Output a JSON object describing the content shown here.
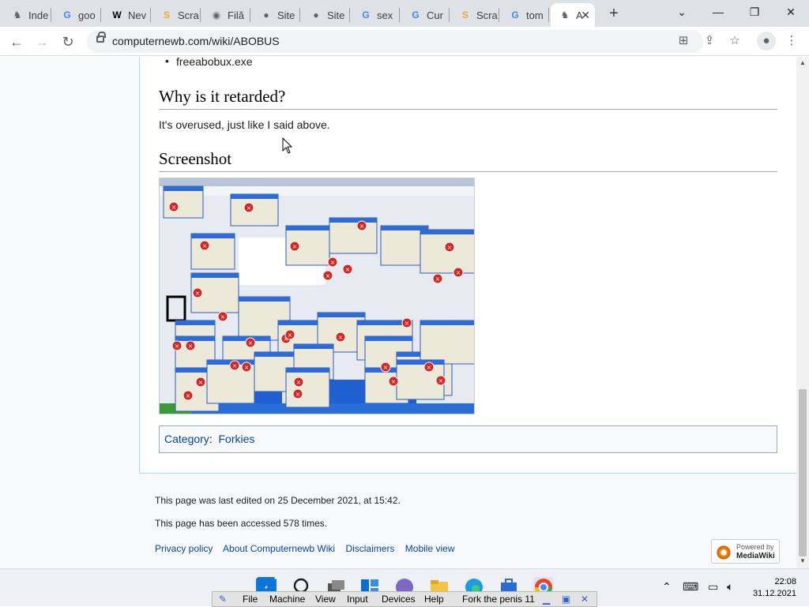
{
  "browser": {
    "tabs": [
      {
        "label": "Inde",
        "icon": "computernewb-icon",
        "icon_glyph": "♞"
      },
      {
        "label": "goo",
        "icon": "google-icon",
        "icon_glyph": "G"
      },
      {
        "label": "Nev",
        "icon": "wikipedia-icon",
        "icon_glyph": "W"
      },
      {
        "label": "Scra",
        "icon": "scratch-icon",
        "icon_glyph": "S"
      },
      {
        "label": "Filă",
        "icon": "chrome-icon",
        "icon_glyph": "◉"
      },
      {
        "label": "Site",
        "icon": "globe-icon",
        "icon_glyph": "●"
      },
      {
        "label": "Site",
        "icon": "globe-icon",
        "icon_glyph": "●"
      },
      {
        "label": "sex",
        "icon": "google-icon",
        "icon_glyph": "G"
      },
      {
        "label": "Cur",
        "icon": "google-icon",
        "icon_glyph": "G"
      },
      {
        "label": "Scra",
        "icon": "scratch-icon",
        "icon_glyph": "S"
      },
      {
        "label": "tom",
        "icon": "google-icon",
        "icon_glyph": "G"
      },
      {
        "label": "A",
        "icon": "computernewb-icon",
        "icon_glyph": "♞",
        "active": true
      }
    ],
    "new_tab": "+",
    "url": "computernewb.com/wiki/ABOBUS"
  },
  "article": {
    "list_item": "freeabobux.exe",
    "heading1": "Why is it retarded?",
    "paragraph1": "It's overused, just like I said above.",
    "heading2": "Screenshot",
    "category_label": "Category",
    "category_sep": ":",
    "category_link": "Forkies"
  },
  "footer": {
    "last_edited": "This page was last edited on 25 December 2021, at 15:42.",
    "accessed": "This page has been accessed 578 times.",
    "links": [
      "Privacy policy",
      "About Computernewb Wiki",
      "Disclaimers",
      "Mobile view"
    ],
    "powered_line1": "Powered by",
    "powered_line2": "MediaWiki"
  },
  "vbox": {
    "menu": [
      "File",
      "Machine",
      "View",
      "Input",
      "Devices",
      "Help"
    ],
    "title": "Fork the penis 11"
  },
  "clock": {
    "time": "22:08",
    "date": "31.12.2021"
  }
}
